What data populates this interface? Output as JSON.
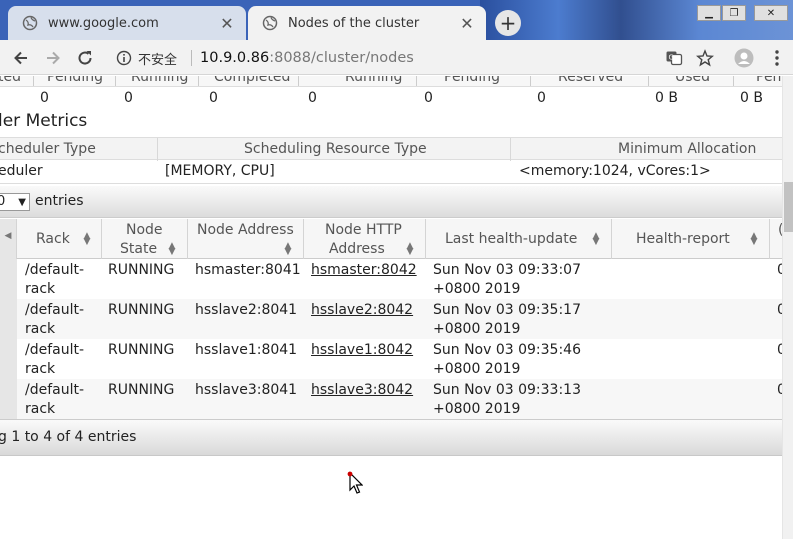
{
  "browser": {
    "tabs": [
      {
        "title": "www.google.com",
        "active": false
      },
      {
        "title": "Nodes of the cluster",
        "active": true
      }
    ],
    "new_tab_symbol": "+",
    "close_symbol": "✕",
    "omnibox": {
      "security_label": "不安全",
      "host": "10.9.0.86",
      "path": ":8088/cluster/nodes"
    },
    "icons": [
      "back-icon",
      "forward-icon",
      "reload-icon",
      "info-icon",
      "translate-icon",
      "star-icon",
      "profile-icon",
      "menu-icon"
    ]
  },
  "cluster_metrics": {
    "headers": [
      "ted",
      "Pending",
      "Running",
      "Completed",
      "Running",
      "Pending",
      "Reserved",
      "Used",
      "Pen"
    ],
    "values": [
      "0",
      "0",
      "0",
      "0",
      "0",
      "0",
      "0 B",
      "0 B"
    ]
  },
  "scheduler": {
    "title": "ler Metrics",
    "headers": [
      "cheduler Type",
      "Scheduling Resource Type",
      "Minimum Allocation"
    ],
    "row": [
      "eduler",
      "[MEMORY, CPU]",
      "<memory:1024, vCores:1>"
    ]
  },
  "entries_control": {
    "value": "0",
    "arrow": "▼",
    "label": "entries"
  },
  "nodes_table": {
    "headers": [
      {
        "line1": "Rack",
        "line2": ""
      },
      {
        "line1": "Node",
        "line2": "State"
      },
      {
        "line1": "Node Address",
        "line2": ""
      },
      {
        "line1": "Node HTTP",
        "line2": "Address"
      },
      {
        "line1": "Last health-update",
        "line2": ""
      },
      {
        "line1": "Health-report",
        "line2": ""
      },
      {
        "line1": "(",
        "line2": ""
      }
    ],
    "sort_symbol": "⌃⌄",
    "rows": [
      {
        "rack1": "/default-",
        "rack2": "rack",
        "state": "RUNNING",
        "address": "hsmaster:8041",
        "http": "hsmaster:8042",
        "update1": "Sun Nov 03 09:33:07",
        "update2": "+0800 2019",
        "health": "",
        "cut": "0"
      },
      {
        "rack1": "/default-",
        "rack2": "rack",
        "state": "RUNNING",
        "address": "hsslave2:8041",
        "http": "hsslave2:8042",
        "update1": "Sun Nov 03 09:35:17",
        "update2": "+0800 2019",
        "health": "",
        "cut": "0"
      },
      {
        "rack1": "/default-",
        "rack2": "rack",
        "state": "RUNNING",
        "address": "hsslave1:8041",
        "http": "hsslave1:8042",
        "update1": "Sun Nov 03 09:35:46",
        "update2": "+0800 2019",
        "health": "",
        "cut": "0"
      },
      {
        "rack1": "/default-",
        "rack2": "rack",
        "state": "RUNNING",
        "address": "hsslave3:8041",
        "http": "hsslave3:8042",
        "update1": "Sun Nov 03 09:33:13",
        "update2": "+0800 2019",
        "health": "",
        "cut": "0"
      }
    ]
  },
  "table_info": "g 1 to 4 of 4 entries",
  "colors": {
    "tabbar": "#3a63b8",
    "toolbar": "#f2f2f2",
    "cursor_dot": "#cc0000"
  }
}
